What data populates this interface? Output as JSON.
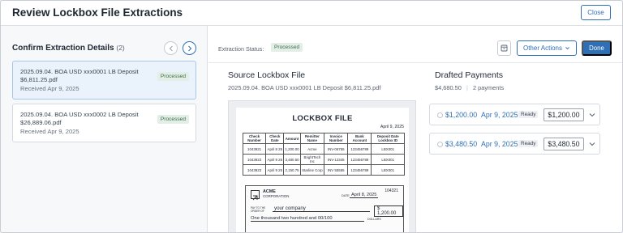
{
  "header": {
    "title": "Review Lockbox File Extractions",
    "close_label": "Close"
  },
  "left": {
    "title": "Confirm Extraction Details",
    "count": "(2)",
    "items": [
      {
        "name_line1": "2025.09.04. BOA USD xxx0001 LB Deposit",
        "name_line2": "$6,811.25.pdf",
        "received": "Received Apr 9, 2025",
        "status": "Processed"
      },
      {
        "name_line1": "2025.09.04. BOA USD xxx0002 LB Deposit",
        "name_line2": "$26,889.06.pdf",
        "received": "Received Apr 9, 2025",
        "status": "Processed"
      }
    ]
  },
  "toolbar": {
    "status_label": "Extraction Status:",
    "status_value": "Processed",
    "other_actions_label": "Other Actions",
    "done_label": "Done"
  },
  "source": {
    "title": "Source Lockbox File",
    "filename": "2025.09.04. BOA USD xxx0001 LB Deposit $6,811.25.pdf"
  },
  "document": {
    "title": "LOCKBOX FILE",
    "date": "April 9, 2025",
    "columns": [
      "Check Number",
      "Check Date",
      "Amount",
      "Remitter Name",
      "Invoice Number",
      "Bank Account",
      "Deposit Date Lockbox ID"
    ],
    "rows": [
      [
        "1043921",
        "April 8 25",
        "1,200.00",
        "Acme",
        "INV-06755",
        "123456789",
        "LBX001"
      ],
      [
        "1043923",
        "April 9 25",
        "3,480.50",
        "BrightTech Inc",
        "INV-12345",
        "123456789",
        "LBX001"
      ],
      [
        "1043923",
        "April 9 25",
        "2,150.75",
        "Starline Corp",
        "INV 55555",
        "123456789",
        "LBX001"
      ]
    ],
    "check": {
      "company": "ACME",
      "company_sub": "CORPORATION",
      "number": "104321",
      "date_label": "DATE",
      "date": "April 8, 2025",
      "pay_label": "PAY TO THE ORDER OF",
      "payee": "your company",
      "amount": "$ 1,200.00",
      "amount_words": "One thousand two hundred and 00/100",
      "dollars_label": "DOLLARS"
    }
  },
  "drafted": {
    "title": "Drafted Payments",
    "total": "$4,680.50",
    "count": "2 payments",
    "payments": [
      {
        "amount": "$1,200.00",
        "date": "Apr 9, 2025",
        "status": "Ready",
        "input_value": "$1,200.00"
      },
      {
        "amount": "$3,480.50",
        "date": "Apr 9, 2025",
        "status": "Ready",
        "input_value": "$3,480.50"
      }
    ]
  }
}
